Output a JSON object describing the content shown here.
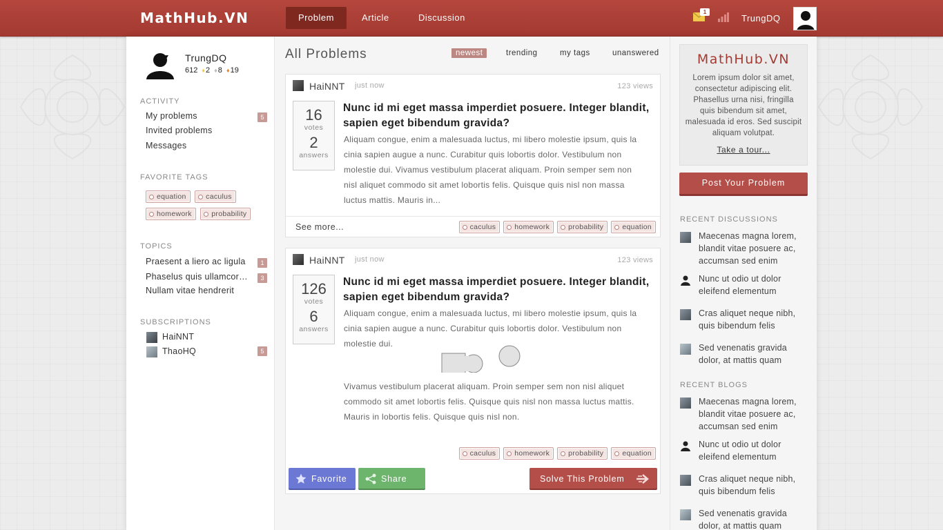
{
  "app": {
    "logo": "MathHub.VN",
    "nav": [
      {
        "label": "Problem",
        "active": true
      },
      {
        "label": "Article",
        "active": false
      },
      {
        "label": "Discussion",
        "active": false
      }
    ],
    "mail_count": "1",
    "user": "TrungDQ"
  },
  "profile": {
    "name": "TrungDQ",
    "reputation": "612",
    "gold": "2",
    "silver": "8",
    "bronze": "19"
  },
  "sidebar": {
    "activity_title": "ACTIVITY",
    "activity": [
      {
        "label": "My problems",
        "count": "5"
      },
      {
        "label": "Invited problems",
        "count": ""
      },
      {
        "label": "Messages",
        "count": ""
      }
    ],
    "tags_title": "FAVORITE TAGS",
    "tags": [
      "equation",
      "caculus",
      "homework",
      "probability"
    ],
    "topics_title": "TOPICS",
    "topics": [
      {
        "label": "Praesent a liero ac ligula",
        "count": "1"
      },
      {
        "label": "Phaselus quis ullamcorper",
        "count": "3"
      },
      {
        "label": "Nullam vitae hendrerit",
        "count": ""
      }
    ],
    "subs_title": "SUBSCRIPTIONS",
    "subs": [
      {
        "name": "HaiNNT",
        "count": ""
      },
      {
        "name": "ThaoHQ",
        "count": "5"
      }
    ]
  },
  "main": {
    "title": "All Problems",
    "filters": [
      {
        "label": "newest",
        "active": true
      },
      {
        "label": "trending",
        "active": false
      },
      {
        "label": "my tags",
        "active": false
      },
      {
        "label": "unanswered",
        "active": false
      }
    ],
    "problems": [
      {
        "author": "HaiNNT",
        "time": "just now",
        "views": "123 views",
        "votes": "16",
        "votes_label": "votes",
        "answers": "2",
        "answers_label": "answers",
        "title": "Nunc id mi eget massa imperdiet posuere. Integer blandit, sapien eget bibendum gravida?",
        "excerpt": "Aliquam congue, enim a malesuada luctus, mi libero molestie ipsum, quis la cinia sapien augue a nunc. Curabitur quis lobortis dolor. Vestibulum non molestie dui. Vivamus vestibulum placerat aliquam. Proin semper sem non nisl aliquet commodo sit amet lobortis felis. Quisque quis nisl non massa luctus mattis. Mauris in...",
        "see_more": "See more...",
        "tags": [
          "caculus",
          "homework",
          "probability",
          "equation"
        ]
      },
      {
        "author": "HaiNNT",
        "time": "just now",
        "views": "123 views",
        "votes": "126",
        "votes_label": "votes",
        "answers": "6",
        "answers_label": "answers",
        "title": "Nunc id mi eget massa imperdiet posuere. Integer blandit, sapien eget bibendum gravida?",
        "excerpt": "Aliquam congue, enim a malesuada luctus, mi libero molestie ipsum, quis la cinia sapien augue a nunc. Curabitur quis lobortis dolor. Vestibulum non molestie dui.",
        "excerpt2": "Vivamus vestibulum placerat aliquam. Proin semper sem non nisl aliquet commodo sit amet lobortis felis. Quisque quis nisl non massa luctus mattis. Mauris in lobortis felis. Quisque quis nisl non.",
        "tags": [
          "caculus",
          "homework",
          "probability",
          "equation"
        ],
        "favorite_label": "Favorite",
        "share_label": "Share",
        "solve_label": "Solve This Problem"
      }
    ]
  },
  "right": {
    "promo_logo": "MathHub.VN",
    "promo_text": "Lorem ipsum dolor sit amet, consectetur adipiscing elit. Phasellus urna nisi, fringilla quis bibendum sit amet, malesuada id eros. Sed suscipit aliquam volutpat.",
    "promo_link": "Take a tour...",
    "post_button": "Post Your Problem",
    "discussions_title": "RECENT DISCUSSIONS",
    "discussions": [
      "Maecenas magna lorem, blandit vitae posuere ac, accumsan sed enim",
      "Nunc ut odio ut dolor eleifend elementum",
      "Cras aliquet neque nibh, quis bibendum felis",
      "Sed venenatis gravida dolor, at mattis quam"
    ],
    "blogs_title": "RECENT BLOGS",
    "blogs": [
      "Maecenas magna lorem, blandit vitae posuere ac, accumsan sed enim",
      "Nunc ut odio ut dolor eleifend elementum",
      "Cras aliquet neque nibh, quis bibendum felis",
      "Sed venenatis gravida dolor, at mattis quam"
    ]
  },
  "colors": {
    "brand": "#a33a32",
    "tag_bg": "#f4e4e2",
    "favorite": "#6b78d4",
    "share": "#6db46c",
    "solve": "#b44e49"
  },
  "icons": [
    "mail-icon",
    "stats-icon",
    "star-icon",
    "share-icon",
    "arrow-right-icon",
    "user-silhouette-icon"
  ]
}
